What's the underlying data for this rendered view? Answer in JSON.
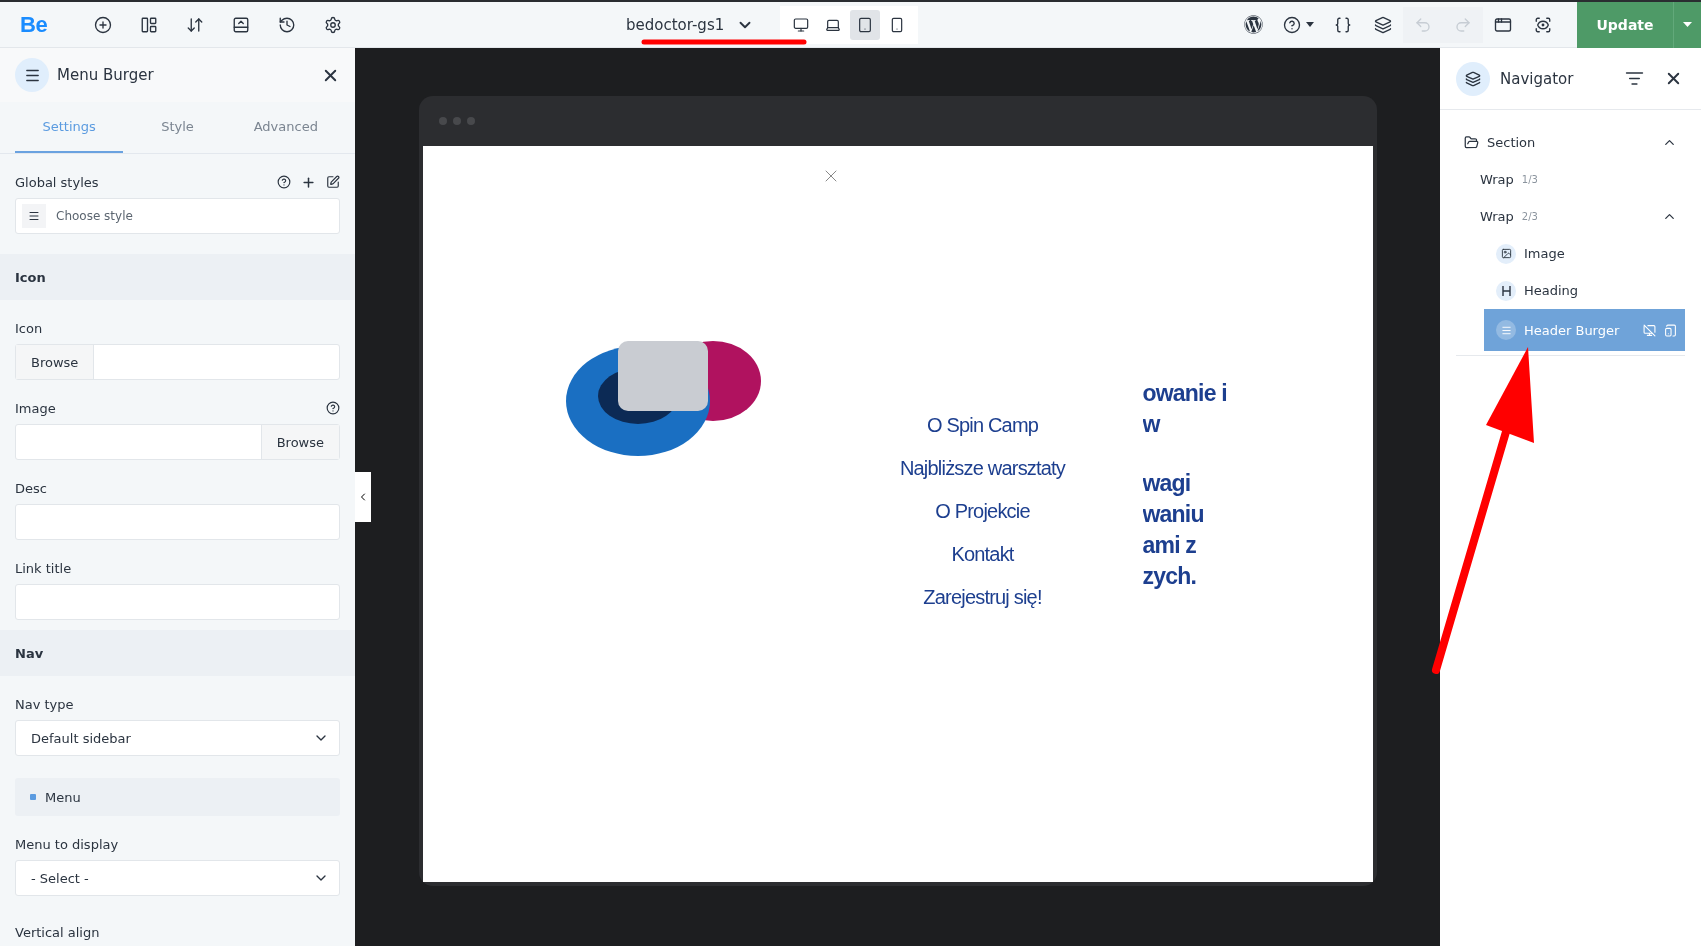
{
  "toolbar": {
    "logo": "Be",
    "left_tools": [
      {
        "kind": "add"
      },
      {
        "kind": "layout"
      },
      {
        "kind": "sort"
      },
      {
        "kind": "template"
      },
      {
        "kind": "history"
      },
      {
        "kind": "settings"
      }
    ],
    "template": "bedoctor-gs1",
    "devices": [
      {
        "kind": "desktop",
        "selected": false
      },
      {
        "kind": "laptop",
        "selected": false
      },
      {
        "kind": "tablet",
        "selected": true
      },
      {
        "kind": "mobile",
        "selected": false
      }
    ],
    "right_tools": [
      {
        "kind": "wordpress",
        "disabled": false
      },
      {
        "kind": "help",
        "disabled": false
      },
      {
        "kind": "css",
        "disabled": false
      },
      {
        "kind": "layers",
        "disabled": false
      },
      {
        "kind": "undo",
        "disabled": true
      },
      {
        "kind": "redo",
        "disabled": true
      },
      {
        "kind": "preview",
        "disabled": false
      },
      {
        "kind": "view",
        "disabled": false
      }
    ],
    "update": "Update"
  },
  "left_panel": {
    "title": "Menu Burger",
    "tabs": [
      {
        "label": "Settings",
        "selected": true
      },
      {
        "label": "Style",
        "selected": false
      },
      {
        "label": "Advanced",
        "selected": false
      }
    ],
    "global_styles": {
      "label": "Global styles",
      "placeholder": "Choose style"
    },
    "items": [
      {
        "kind": "section",
        "label": "Icon"
      },
      {
        "kind": "browse_left",
        "label": "Icon",
        "button": "Browse",
        "help": false
      },
      {
        "kind": "browse_right",
        "label": "Image",
        "button": "Browse",
        "help": true
      },
      {
        "kind": "text",
        "label": "Desc"
      },
      {
        "kind": "text",
        "label": "Link title"
      },
      {
        "kind": "section",
        "label": "Nav"
      },
      {
        "kind": "select",
        "label": "Nav type",
        "value": "Default sidebar"
      },
      {
        "kind": "group",
        "label": "Menu"
      },
      {
        "kind": "select",
        "label": "Menu to display",
        "value": "- Select -"
      },
      {
        "kind": "label",
        "label": "Vertical align"
      }
    ]
  },
  "canvas": {
    "menu": [
      "O Spin Camp",
      "Najbliższe warsztaty",
      "O Projekcie",
      "Kontakt",
      "Zarejestruj się!"
    ],
    "heading_blocks": [
      [
        "owanie i",
        "w"
      ],
      [
        "wagi",
        "waniu",
        "ami z",
        "zych."
      ]
    ]
  },
  "navigator": {
    "title": "Navigator",
    "tree": [
      {
        "label": "Section",
        "kind": "section",
        "expanded": true,
        "selected": false,
        "children": [
          {
            "label": "Wrap",
            "count": "1/3",
            "expanded": false,
            "selected": false
          },
          {
            "label": "Wrap",
            "count": "2/3",
            "expanded": true,
            "selected": false,
            "children": [
              {
                "label": "Image",
                "kind": "image",
                "expanded": false,
                "selected": false
              },
              {
                "label": "Heading",
                "kind": "heading",
                "expanded": false,
                "selected": false
              },
              {
                "label": "Header Burger",
                "kind": "burger",
                "expanded": false,
                "selected": true
              }
            ]
          }
        ]
      }
    ]
  }
}
